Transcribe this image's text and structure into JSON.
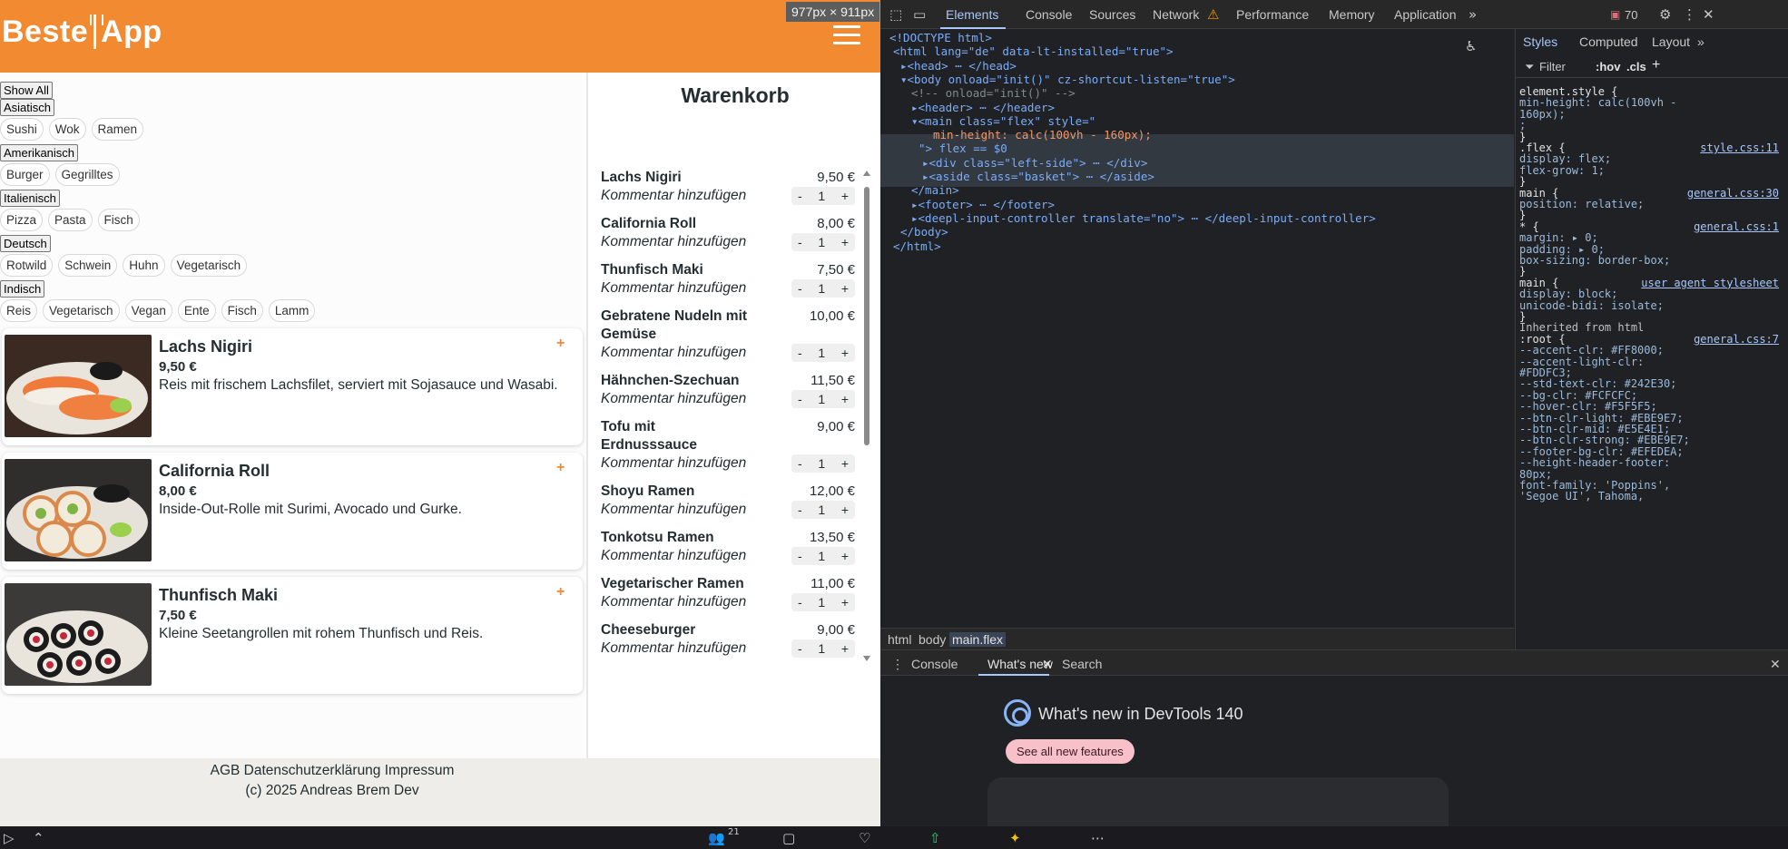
{
  "size_badge": "977px × 911px",
  "app": {
    "logo": {
      "left": "Beste",
      "right": "App"
    },
    "categories": [
      {
        "label": "Show All",
        "tags": []
      },
      {
        "label": "Asiatisch",
        "tags": [
          "Sushi",
          "Wok",
          "Ramen"
        ]
      },
      {
        "label": "Amerikanisch",
        "tags": [
          "Burger",
          "Gegrilltes"
        ]
      },
      {
        "label": "Italienisch",
        "tags": [
          "Pizza",
          "Pasta",
          "Fisch"
        ]
      },
      {
        "label": "Deutsch",
        "tags": [
          "Rotwild",
          "Schwein",
          "Huhn",
          "Vegetarisch"
        ]
      },
      {
        "label": "Indisch",
        "tags": [
          "Reis",
          "Vegetarisch",
          "Vegan",
          "Ente",
          "Fisch",
          "Lamm"
        ]
      }
    ],
    "menu": [
      {
        "name": "Lachs Nigiri",
        "price": "9,50 €",
        "desc": "Reis mit frischem Lachsfilet, serviert mit Sojasauce und Wasabi.",
        "add": "+"
      },
      {
        "name": "California Roll",
        "price": "8,00 €",
        "desc": "Inside-Out-Rolle mit Surimi, Avocado und Gurke.",
        "add": "+"
      },
      {
        "name": "Thunfisch Maki",
        "price": "7,50 €",
        "desc": "Kleine Seetangrollen mit rohem Thunfisch und Reis.",
        "add": "+"
      }
    ],
    "basket": {
      "title": "Warenkorb",
      "comment_label": "Kommentar hinzufügen",
      "minus": "-",
      "plus": "+",
      "items": [
        {
          "name": "Lachs Nigiri",
          "price": "9,50 €",
          "qty": "1"
        },
        {
          "name": "California Roll",
          "price": "8,00 €",
          "qty": "1"
        },
        {
          "name": "Thunfisch Maki",
          "price": "7,50 €",
          "qty": "1"
        },
        {
          "name": "Gebratene Nudeln mit Gemüse",
          "price": "10,00 €",
          "qty": "1"
        },
        {
          "name": "Hähnchen-Szechuan",
          "price": "11,50 €",
          "qty": "1"
        },
        {
          "name": "Tofu mit Erdnusssauce",
          "price": "9,00 €",
          "qty": "1"
        },
        {
          "name": "Shoyu Ramen",
          "price": "12,00 €",
          "qty": "1"
        },
        {
          "name": "Tonkotsu Ramen",
          "price": "13,50 €",
          "qty": "1"
        },
        {
          "name": "Vegetarischer Ramen",
          "price": "11,00 €",
          "qty": "1"
        },
        {
          "name": "Cheeseburger",
          "price": "9,00 €",
          "qty": "1"
        }
      ]
    },
    "footer": {
      "links": "AGB Datenschutzerklärung Impressum",
      "copy": "(c) 2025 Andreas Brem Dev"
    }
  },
  "devtools": {
    "tabs": [
      "Elements",
      "Console",
      "Sources",
      "Network",
      "Performance",
      "Memory",
      "Application"
    ],
    "issues_count": "70",
    "dom_lines": [
      {
        "t": "<!DOCTYPE html>"
      },
      {
        "t": "<html lang=\"de\" data-lt-installed=\"true\">"
      },
      {
        "t": "▸<head> ⋯ </head>"
      },
      {
        "t": "▾<body onload=\"init()\" cz-shortcut-listen=\"true\">"
      },
      {
        "t": "<!-- onload=\"init()\" -->"
      },
      {
        "t": "▸<header> ⋯ </header>"
      },
      {
        "t": "▾<main class=\"flex\" style=\""
      },
      {
        "t": "min-height: calc(100vh - 160px);"
      },
      {
        "t": "\"> flex == $0"
      },
      {
        "t": "▸<div class=\"left-side\"> ⋯ </div>"
      },
      {
        "t": "▸<aside class=\"basket\"> ⋯ </aside>"
      },
      {
        "t": "</main>"
      },
      {
        "t": "▸<footer> ⋯ </footer>"
      },
      {
        "t": "▸<deepl-input-controller translate=\"no\"> ⋯ </deepl-input-controller>"
      },
      {
        "t": "</body>"
      },
      {
        "t": "</html>"
      }
    ],
    "breadcrumbs": [
      "html",
      "body",
      "main.flex"
    ],
    "styles_tabs": [
      "Styles",
      "Computed",
      "Layout"
    ],
    "filter": {
      "placeholder": "Filter",
      "hov": ":hov",
      "cls": ".cls"
    },
    "style_lines": [
      {
        "text": "element.style {",
        "src": ""
      },
      {
        "text": "  min-height: calc(100vh -",
        "src": ""
      },
      {
        "text": "      160px);",
        "src": ""
      },
      {
        "text": "  ;",
        "src": ""
      },
      {
        "text": "}",
        "src": ""
      },
      {
        "text": ".flex {",
        "src": "style.css:11"
      },
      {
        "text": "  display: flex;",
        "src": ""
      },
      {
        "text": "  flex-grow: 1;",
        "src": ""
      },
      {
        "text": "}",
        "src": ""
      },
      {
        "text": "main {",
        "src": "general.css:30"
      },
      {
        "text": "  position: relative;",
        "src": ""
      },
      {
        "text": "}",
        "src": ""
      },
      {
        "text": "* {",
        "src": "general.css:1"
      },
      {
        "text": "  margin: ▸ 0;",
        "src": ""
      },
      {
        "text": "  padding: ▸ 0;",
        "src": ""
      },
      {
        "text": "  box-sizing: border-box;",
        "src": ""
      },
      {
        "text": "}",
        "src": ""
      },
      {
        "text": "main {",
        "src": "user agent stylesheet"
      },
      {
        "text": "  display: block;",
        "src": ""
      },
      {
        "text": "  unicode-bidi: isolate;",
        "src": ""
      },
      {
        "text": "}",
        "src": ""
      },
      {
        "text": "Inherited from html",
        "src": ""
      },
      {
        "text": ":root {",
        "src": "general.css:7"
      },
      {
        "text": "  --accent-clr: #FF8000;",
        "src": ""
      },
      {
        "text": "  --accent-light-clr:",
        "src": ""
      },
      {
        "text": "      #FDDFC3;",
        "src": ""
      },
      {
        "text": "  --std-text-clr: #242E30;",
        "src": ""
      },
      {
        "text": "  --bg-clr: #FCFCFC;",
        "src": ""
      },
      {
        "text": "  --hover-clr: #F5F5F5;",
        "src": ""
      },
      {
        "text": "  --btn-clr-light: #EBE9E7;",
        "src": ""
      },
      {
        "text": "  --btn-clr-mid: #E5E4E1;",
        "src": ""
      },
      {
        "text": "  --btn-clr-strong: #EBE9E7;",
        "src": ""
      },
      {
        "text": "  --footer-bg-clr: #EFEDEA;",
        "src": ""
      },
      {
        "text": "  --height-header-footer:",
        "src": ""
      },
      {
        "text": "      80px;",
        "src": ""
      },
      {
        "text": "  font-family: 'Poppins',",
        "src": ""
      },
      {
        "text": "      'Segoe UI', Tahoma,",
        "src": ""
      }
    ],
    "drawer_tabs": [
      "Console",
      "What's new",
      "Search"
    ],
    "whats_new_title": "What's new in DevTools 140",
    "see_all": "See all new features"
  },
  "colors": {
    "accent": "#f28a32",
    "text": "#242e30",
    "footer": "#efedea"
  },
  "taskbar": {
    "badge": "21"
  }
}
